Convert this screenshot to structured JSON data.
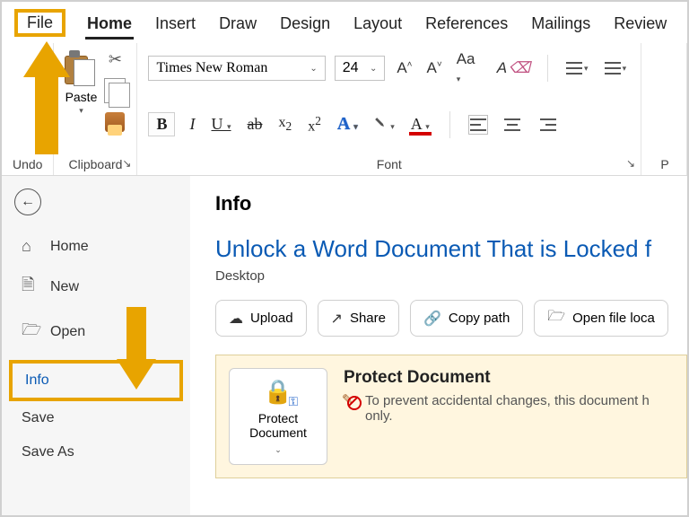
{
  "tabs": {
    "file": "File",
    "home": "Home",
    "insert": "Insert",
    "draw": "Draw",
    "design": "Design",
    "layout": "Layout",
    "references": "References",
    "mailings": "Mailings",
    "review": "Review"
  },
  "ribbon": {
    "undo_label": "Undo",
    "clipboard_label": "Clipboard",
    "paste_label": "Paste",
    "font_label": "Font",
    "font_name": "Times New Roman",
    "font_size": "24",
    "para_label": "P"
  },
  "backstage": {
    "info_heading": "Info",
    "side": {
      "home": "Home",
      "new": "New",
      "open": "Open",
      "info": "Info",
      "save": "Save",
      "saveas": "Save As"
    },
    "doc_title": "Unlock a Word Document That is Locked f",
    "doc_location": "Desktop",
    "actions": {
      "upload": "Upload",
      "share": "Share",
      "copy_path": "Copy path",
      "open_loc": "Open file loca"
    },
    "protect": {
      "button": "Protect Document",
      "title": "Protect Document",
      "body": "To prevent accidental changes, this document h",
      "body2": "only."
    }
  }
}
